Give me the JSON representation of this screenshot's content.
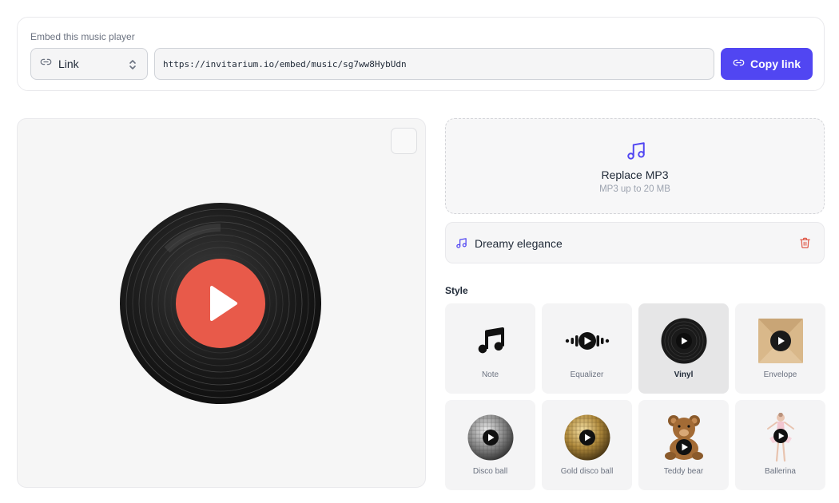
{
  "embed": {
    "title": "Embed this music player",
    "type_label": "Link",
    "url": "https://invitarium.io/embed/music/sg7ww8HybUdn",
    "copy_label": "Copy link"
  },
  "upload": {
    "title": "Replace MP3",
    "subtitle": "MP3 up to 20 MB"
  },
  "track": {
    "name": "Dreamy elegance"
  },
  "style": {
    "heading": "Style",
    "selected": "Vinyl",
    "options": [
      {
        "label": "Note",
        "icon": "music-note-icon"
      },
      {
        "label": "Equalizer",
        "icon": "equalizer-icon"
      },
      {
        "label": "Vinyl",
        "icon": "vinyl-record-icon"
      },
      {
        "label": "Envelope",
        "icon": "envelope-icon"
      },
      {
        "label": "Disco ball",
        "icon": "disco-ball-icon"
      },
      {
        "label": "Gold disco ball",
        "icon": "gold-disco-ball-icon"
      },
      {
        "label": "Teddy bear",
        "icon": "teddy-bear-icon"
      },
      {
        "label": "Ballerina",
        "icon": "ballerina-icon"
      }
    ]
  },
  "colors": {
    "accent": "#5146f2",
    "play_label": "#e85a4a",
    "delete": "#e05a4a"
  }
}
